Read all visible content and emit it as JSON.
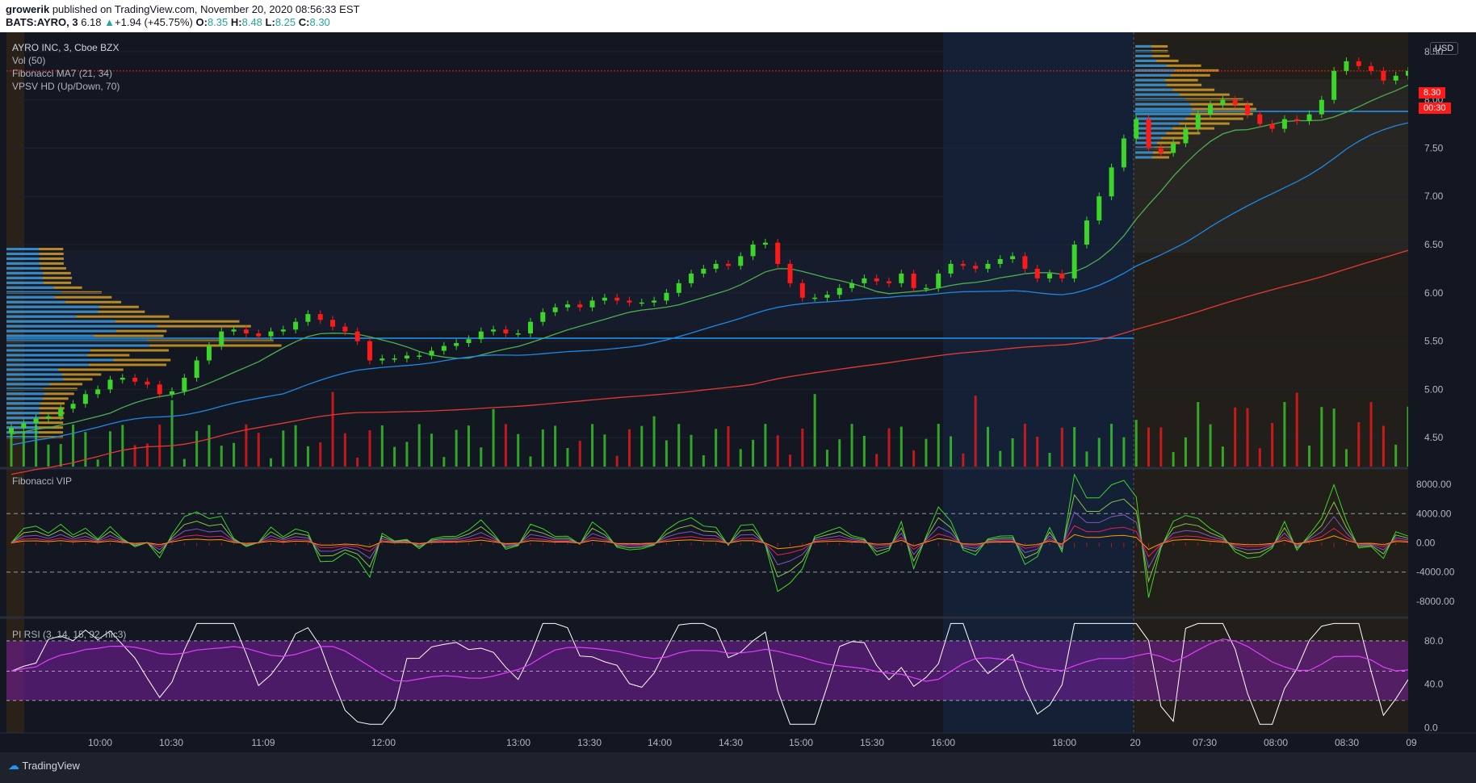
{
  "header": {
    "author": "growerik",
    "published": "published on TradingView.com, November 20, 2020 08:56:33 EST",
    "symbol": "BATS:AYRO, 3",
    "last": "6.18",
    "change": "+1.94 (+45.75%)",
    "o_label": "O:",
    "o": "8.35",
    "h_label": "H:",
    "h": "8.48",
    "l_label": "L:",
    "l": "8.25",
    "c_label": "C:",
    "c": "8.30"
  },
  "legend": {
    "title": "AYRO INC, 3, Cboe BZX",
    "vol": "Vol (50)",
    "ma": "Fibonacci MA7 (21, 34)",
    "vpsv": "VPSV HD (Up/Down, 70)",
    "vip": "Fibonacci VIP",
    "rsi": "PI RSI (3, 14, 15, 92, hlc3)"
  },
  "currency": "USD",
  "price_tag": "8.30",
  "countdown": "00:30",
  "footer": {
    "brand": "TradingView"
  },
  "colors": {
    "up": "#3cd62a",
    "down": "#ff1a1a",
    "bg": "#131722",
    "blue_line": "#2196f3",
    "rsi_band": "#7b1fa2",
    "amber": "#e0a526"
  },
  "chart_data": [
    {
      "type": "candlestick",
      "title": "AYRO INC, 3, Cboe BZX",
      "x_ticks": [
        "10:00",
        "10:30",
        "11:09",
        "12:00",
        "13:00",
        "13:30",
        "14:00",
        "14:30",
        "15:00",
        "15:30",
        "16:00",
        "18:00",
        "20",
        "07:30",
        "08:00",
        "08:30",
        "09"
      ],
      "y_ticks": [
        8.5,
        8.0,
        7.5,
        7.0,
        6.5,
        6.0,
        5.5,
        5.0,
        4.5
      ],
      "ylim": [
        4.2,
        8.7
      ],
      "point_of_control_lines": [
        5.53,
        7.88
      ],
      "last_close": 8.3,
      "approx_closes": [
        4.6,
        4.65,
        4.7,
        4.72,
        4.8,
        4.85,
        4.95,
        5.0,
        5.1,
        5.12,
        5.08,
        5.05,
        4.95,
        4.98,
        5.12,
        5.3,
        5.45,
        5.6,
        5.62,
        5.58,
        5.55,
        5.6,
        5.62,
        5.7,
        5.78,
        5.72,
        5.65,
        5.6,
        5.5,
        5.3,
        5.32,
        5.32,
        5.35,
        5.35,
        5.4,
        5.45,
        5.48,
        5.52,
        5.6,
        5.62,
        5.58,
        5.58,
        5.7,
        5.8,
        5.85,
        5.88,
        5.85,
        5.92,
        5.95,
        5.92,
        5.9,
        5.9,
        5.92,
        6.0,
        6.1,
        6.2,
        6.25,
        6.3,
        6.28,
        6.38,
        6.5,
        6.52,
        6.3,
        6.1,
        5.95,
        5.95,
        5.98,
        6.05,
        6.1,
        6.15,
        6.12,
        6.1,
        6.2,
        6.05,
        6.05,
        6.2,
        6.3,
        6.28,
        6.25,
        6.3,
        6.35,
        6.38,
        6.25,
        6.15,
        6.2,
        6.15,
        6.5,
        6.75,
        7.0,
        7.3,
        7.6,
        7.8,
        7.5,
        7.45,
        7.55,
        7.7,
        7.85,
        7.95,
        8.0,
        7.95,
        7.85,
        7.75,
        7.7,
        7.8,
        7.78,
        7.85,
        8.0,
        8.3,
        8.4,
        8.35,
        8.3,
        8.2,
        8.25,
        8.3
      ]
    },
    {
      "type": "line",
      "title": "Fibonacci VIP",
      "y_ticks": [
        8000,
        4000,
        0,
        -4000,
        -8000
      ],
      "reference_lines": [
        4000,
        -4000
      ]
    },
    {
      "type": "line",
      "title": "PI RSI (3, 14, 15, 92, hlc3)",
      "y_ticks": [
        80,
        40,
        0
      ],
      "band": [
        25,
        80
      ]
    }
  ]
}
